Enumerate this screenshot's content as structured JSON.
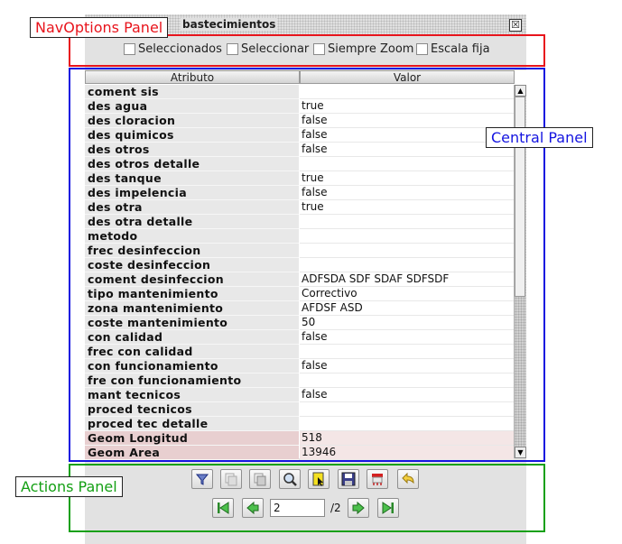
{
  "window": {
    "title": "bastecimientos",
    "close_glyph": "☒"
  },
  "nav_options": {
    "items": [
      {
        "label": "Seleccionados",
        "checked": false
      },
      {
        "label": "Seleccionar",
        "checked": false
      },
      {
        "label": "Siempre Zoom",
        "checked": false
      },
      {
        "label": "Escala fija",
        "checked": false
      }
    ]
  },
  "table": {
    "headers": {
      "attribute": "Atributo",
      "value": "Valor"
    },
    "rows": [
      {
        "attr": "coment sis",
        "value": ""
      },
      {
        "attr": "des agua",
        "value": "true"
      },
      {
        "attr": "des cloracion",
        "value": "false"
      },
      {
        "attr": "des quimicos",
        "value": "false"
      },
      {
        "attr": "des otros",
        "value": "false"
      },
      {
        "attr": "des otros detalle",
        "value": ""
      },
      {
        "attr": "des tanque",
        "value": "true"
      },
      {
        "attr": "des impelencia",
        "value": "false"
      },
      {
        "attr": "des otra",
        "value": "true"
      },
      {
        "attr": "des otra detalle",
        "value": ""
      },
      {
        "attr": "metodo",
        "value": ""
      },
      {
        "attr": "frec desinfeccion",
        "value": ""
      },
      {
        "attr": "coste desinfeccion",
        "value": ""
      },
      {
        "attr": "coment desinfeccion",
        "value": "ADFSDA SDF SDAF SDFSDF"
      },
      {
        "attr": "tipo mantenimiento",
        "value": "Correctivo"
      },
      {
        "attr": "zona mantenimiento",
        "value": "AFDSF ASD"
      },
      {
        "attr": "coste mantenimiento",
        "value": "50"
      },
      {
        "attr": "con calidad",
        "value": "false"
      },
      {
        "attr": "frec con calidad",
        "value": ""
      },
      {
        "attr": "con funcionamiento",
        "value": "false"
      },
      {
        "attr": "fre con funcionamiento",
        "value": ""
      },
      {
        "attr": "mant tecnicos",
        "value": "false"
      },
      {
        "attr": "proced tecnicos",
        "value": ""
      },
      {
        "attr": "proced tec detalle",
        "value": ""
      },
      {
        "attr": "Geom Longitud",
        "value": "518",
        "highlight": true
      },
      {
        "attr": "Geom Area",
        "value": "13946",
        "highlight": true
      }
    ]
  },
  "actions": {
    "toolbar": [
      {
        "name": "filter-icon"
      },
      {
        "name": "copy-selected-icon"
      },
      {
        "name": "copy-icon"
      },
      {
        "name": "zoom-icon"
      },
      {
        "name": "select-icon"
      },
      {
        "name": "save-icon"
      },
      {
        "name": "delete-icon"
      },
      {
        "name": "undo-icon"
      }
    ],
    "pager": {
      "current_page": "2",
      "total_label": "/2"
    }
  },
  "annotations": {
    "nav_label": "NavOptions Panel",
    "nav_color": "#e8141c",
    "central_label": "Central Panel",
    "central_color": "#1414e0",
    "actions_label": "Actions Panel",
    "actions_color": "#14a014"
  }
}
